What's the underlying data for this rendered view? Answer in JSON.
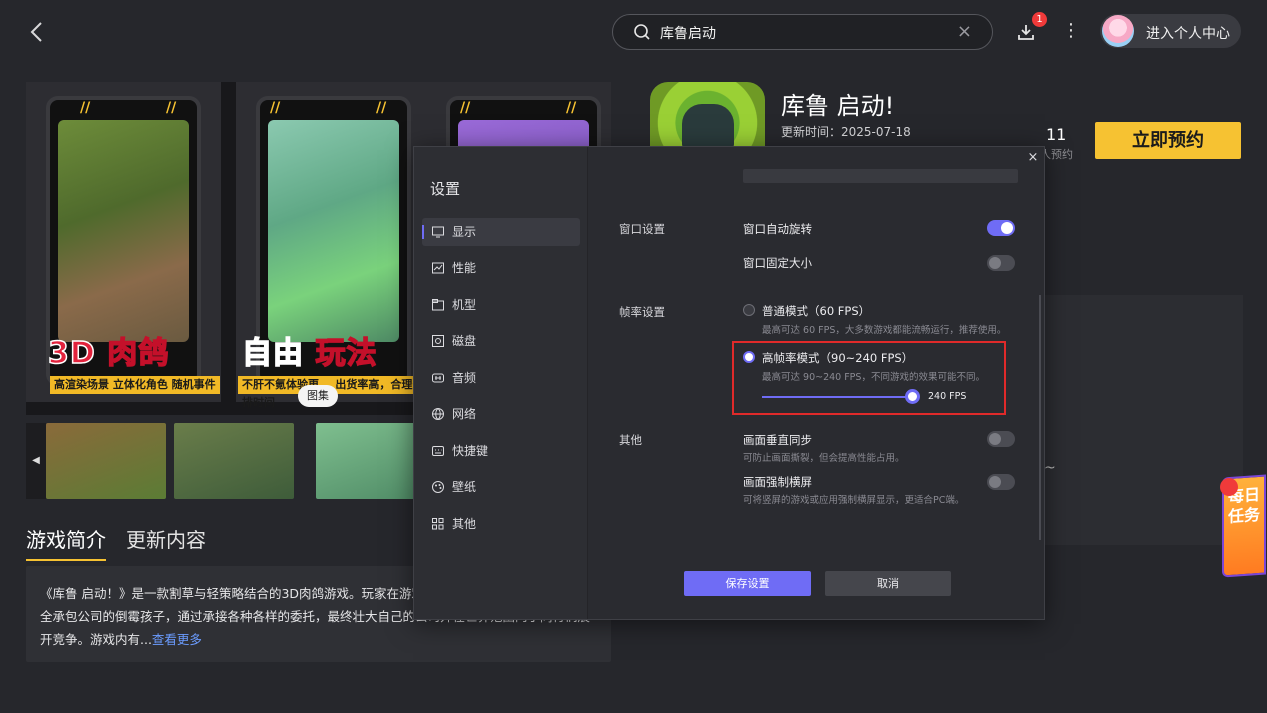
{
  "header": {
    "search_value": "库鲁启动",
    "download_badge": "1",
    "user_center_label": "进入个人中心"
  },
  "gallery": {
    "tag": "图集",
    "shots": [
      {
        "big_left": "3D",
        "big_right": "肉鸽",
        "sub": "高渲染场景 立体化角色  随机事件"
      },
      {
        "big_left": "自由",
        "big_right": "玩法",
        "sub": "不肝不氪体验更... 出货率高，合理安排时间"
      },
      {
        "big_left": "",
        "big_right": "",
        "sub": ""
      }
    ]
  },
  "intro": {
    "tabs": [
      "游戏简介",
      "更新内容"
    ],
    "text": "《库鲁 启动！》是一款割草与轻策略结合的3D肉鸽游戏。玩家在游戏中扮演一名接盘自家破败的安全承包公司的倒霉孩子，通过承接各种各样的委托，最终壮大自己的公司并在世界范围内于同行们展开竞争。游戏内有...",
    "more_link": "查看更多"
  },
  "app": {
    "title": "库鲁 启动!",
    "update_time": "更新时间：2025-07-18",
    "reserve_count": "11",
    "reserve_count_label": "人预约",
    "reserve_button": "立即预约"
  },
  "daily_task": "每日任务",
  "settings": {
    "title": "设置",
    "sidebar": [
      {
        "label": "显示",
        "icon": "monitor-icon"
      },
      {
        "label": "性能",
        "icon": "performance-icon"
      },
      {
        "label": "机型",
        "icon": "device-model-icon"
      },
      {
        "label": "磁盘",
        "icon": "disk-icon"
      },
      {
        "label": "音频",
        "icon": "audio-icon"
      },
      {
        "label": "网络",
        "icon": "network-icon"
      },
      {
        "label": "快捷键",
        "icon": "keyboard-icon"
      },
      {
        "label": "壁纸",
        "icon": "wallpaper-icon"
      },
      {
        "label": "其他",
        "icon": "grid-icon"
      }
    ],
    "window_section": "窗口设置",
    "window_options": [
      {
        "label": "窗口自动旋转",
        "on": true
      },
      {
        "label": "窗口固定大小",
        "on": false
      }
    ],
    "fps_section": "帧率设置",
    "fps_options": [
      {
        "label": "普通模式（60 FPS）",
        "hint": "最高可达 60 FPS，大多数游戏都能流畅运行，推荐使用。",
        "selected": false
      },
      {
        "label": "高帧率模式（90~240 FPS）",
        "hint": "最高可达 90~240 FPS，不同游戏的效果可能不同。",
        "selected": true
      }
    ],
    "fps_value": "240 FPS",
    "other_section": "其他",
    "other_options": [
      {
        "label": "画面垂直同步",
        "hint": "可防止画面撕裂，但会提高性能占用。",
        "on": false
      },
      {
        "label": "画面强制横屏",
        "hint": "可将竖屏的游戏或应用强制横屏显示，更适合PC端。",
        "on": false
      }
    ],
    "save_button": "保存设置",
    "cancel_button": "取消",
    "close_glyph": "×"
  }
}
